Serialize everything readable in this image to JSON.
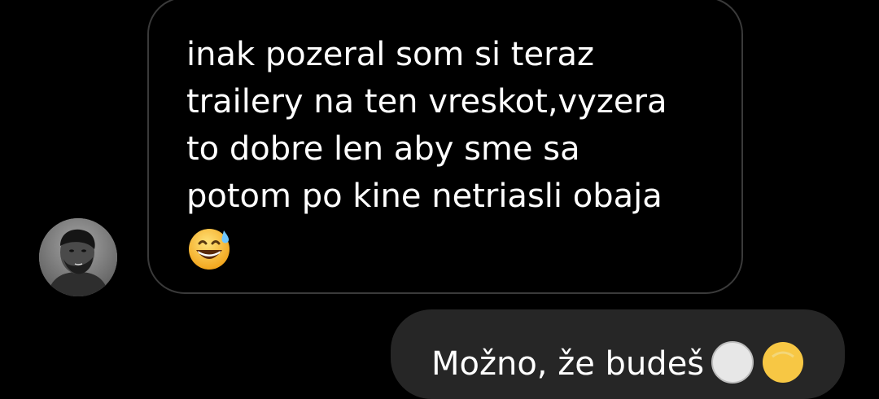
{
  "conversation": {
    "incoming": {
      "text": "inak pozeral som si teraz\ntrailery na ten vreskot,vyzera\nto dobre len aby sme sa\npotom po kine netriasli obaja",
      "trailing_emoji": "grinning-face-with-sweat"
    },
    "outgoing": {
      "text_partial": "Možno, že budeš",
      "trailing_emojis": [
        "face-partially-visible",
        "face-partially-visible"
      ]
    }
  },
  "colors": {
    "background": "#000000",
    "incoming_bubble_border": "#3a3a3a",
    "outgoing_bubble_fill": "#262626",
    "text": "#ffffff"
  }
}
